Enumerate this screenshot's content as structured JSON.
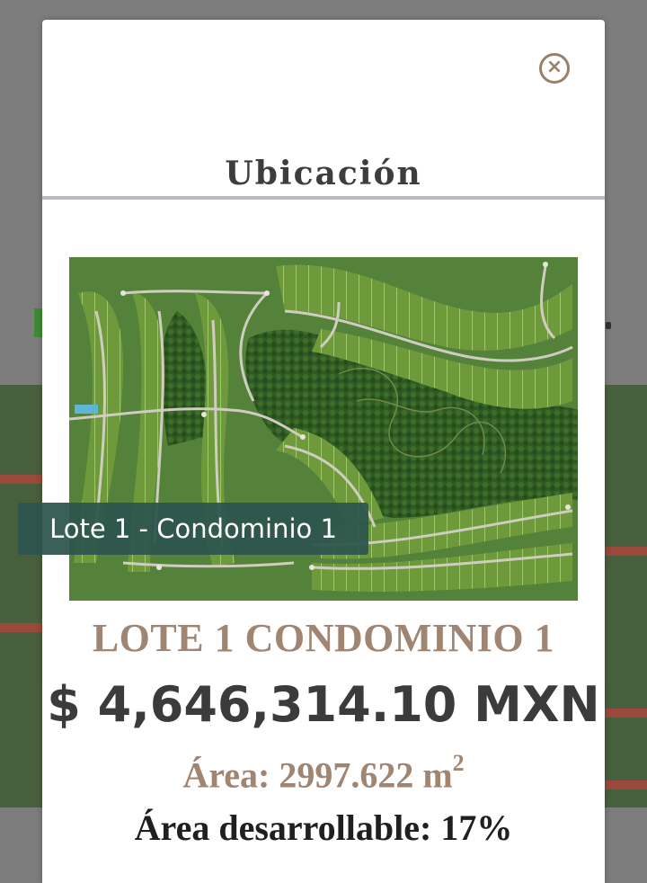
{
  "modal": {
    "title": "Ubicación",
    "close_icon": "close-circle-icon"
  },
  "map": {
    "description_icon": "aerial-site-plan-image",
    "tooltip": "Lote 1 - Condominio 1"
  },
  "lot": {
    "name": "LOTE 1 CONDOMINIO 1",
    "price": "$ 4,646,314.10 MXN",
    "area_label": "Área: 2997.622 m",
    "area_unit_exponent": "2",
    "developable_area": "Área desarrollable: 17%"
  },
  "colors": {
    "accent": "#a08672",
    "title": "#3d3d3d",
    "tooltip_bg": "#2c544e"
  }
}
